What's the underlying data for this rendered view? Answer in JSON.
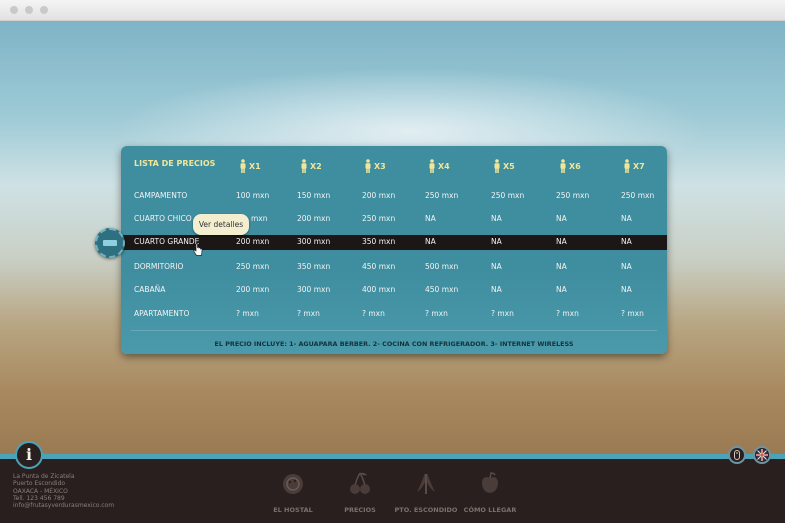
{
  "window": {
    "title": ""
  },
  "table": {
    "title": "LISTA DE PRECIOS",
    "columns": [
      "X1",
      "X2",
      "X3",
      "X4",
      "X5",
      "X6",
      "X7"
    ],
    "rows": [
      {
        "name": "CAMPAMENTO",
        "values": [
          "100 mxn",
          "150 mxn",
          "200 mxn",
          "250 mxn",
          "250 mxn",
          "250 mxn",
          "250 mxn"
        ]
      },
      {
        "name": "CUARTO CHICO",
        "values": [
          "mxn",
          "200 mxn",
          "250 mxn",
          "NA",
          "NA",
          "NA",
          "NA"
        ]
      },
      {
        "name": "CUARTO GRANDE",
        "values": [
          "200 mxn",
          "300 mxn",
          "350 mxn",
          "NA",
          "NA",
          "NA",
          "NA"
        ]
      },
      {
        "name": "DORMITORIO",
        "values": [
          "250 mxn",
          "350 mxn",
          "450 mxn",
          "500 mxn",
          "NA",
          "NA",
          "NA"
        ]
      },
      {
        "name": "CABAÑA",
        "values": [
          "200 mxn",
          "300 mxn",
          "400 mxn",
          "450 mxn",
          "NA",
          "NA",
          "NA"
        ]
      },
      {
        "name": "APARTAMENTO",
        "values": [
          "? mxn",
          "? mxn",
          "? mxn",
          "? mxn",
          "? mxn",
          "? mxn",
          "? mxn"
        ]
      }
    ],
    "selected_row": "CUARTO GRANDE",
    "footnote": "EL PRECIO INCLUYE: 1- AGUAPARA BERBER. 2- COCINA CON REFRIGERADOR. 3- INTERNET WIRELESS"
  },
  "tooltip": {
    "text": "Ver detalles"
  },
  "footer": {
    "info_icon": "i",
    "address": [
      "La Punta de Zicatela",
      "Puerto Escondido",
      "OAXACA - MÉXICO",
      "Tell. 123 456 789",
      "info@frutasyverdurasmexico.com"
    ],
    "nav": [
      {
        "label": "EL HOSTAL",
        "icon": "coconut-icon"
      },
      {
        "label": "PRECIOS",
        "icon": "cherries-icon"
      },
      {
        "label": "PTO. ESCONDIDO",
        "icon": "banana-icon"
      },
      {
        "label": "CÓMO LLEGAR",
        "icon": "apple-icon"
      }
    ]
  },
  "colors": {
    "panel": "#3e8ea0",
    "header_text": "#f0e69a",
    "selected_row": "#1c1716",
    "footer": "#2a1f1f",
    "stripe": "#4aa3b8"
  }
}
